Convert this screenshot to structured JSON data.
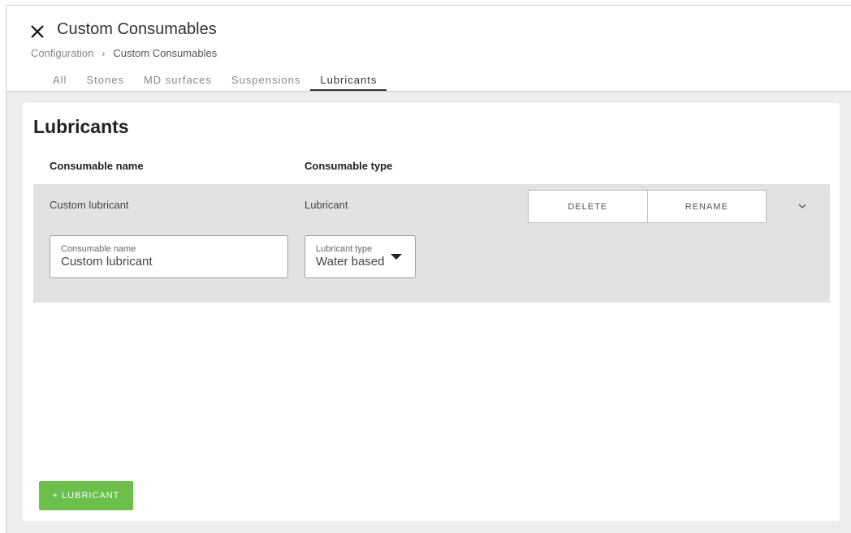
{
  "header": {
    "title": "Custom Consumables",
    "close_icon": "close-icon",
    "breadcrumb": {
      "root": "Configuration",
      "separator": "›",
      "current": "Custom Consumables"
    }
  },
  "tabs": [
    {
      "label": "All",
      "active": false
    },
    {
      "label": "Stones",
      "active": false
    },
    {
      "label": "MD surfaces",
      "active": false
    },
    {
      "label": "Suspensions",
      "active": false
    },
    {
      "label": "Lubricants",
      "active": true
    }
  ],
  "panel": {
    "title": "Lubricants",
    "columns": {
      "name": "Consumable name",
      "type": "Consumable type"
    },
    "rows": [
      {
        "name": "Custom lubricant",
        "type": "Lubricant",
        "actions": {
          "delete": "DELETE",
          "rename": "RENAME"
        },
        "expanded": true,
        "edit": {
          "name_field": {
            "label": "Consumable name",
            "value": "Custom lubricant"
          },
          "type_field": {
            "label": "Lubricant type",
            "value": "Water based"
          }
        }
      }
    ],
    "add_button": "+ LUBRICANT"
  },
  "colors": {
    "accent_green": "#6cbf4a",
    "row_bg": "#e2e2e2",
    "content_bg": "#ededed"
  }
}
